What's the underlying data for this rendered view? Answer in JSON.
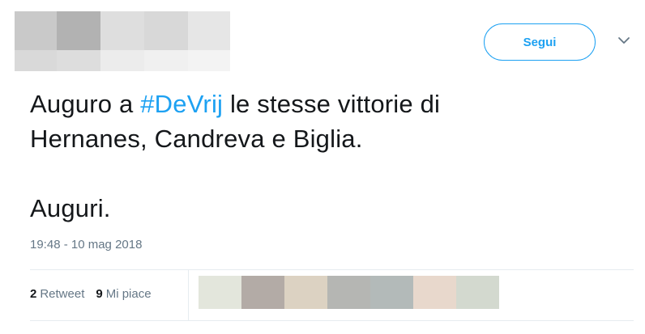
{
  "header": {
    "follow_label": "Segui",
    "chevron_icon": "chevron-down-icon",
    "accent_color": "#1da1f2"
  },
  "tweet": {
    "line1_before": "Auguro a ",
    "hashtag": "#DeVrij",
    "line1_after": " le stesse vittorie di",
    "line2": "Hernanes, Candreva e Biglia.",
    "line3": "Auguri.",
    "timestamp": "19:48 - 10 mag 2018"
  },
  "stats": {
    "retweet_count": "2",
    "retweet_label": "Retweet",
    "like_count": "9",
    "like_label": "Mi piace"
  },
  "liker_avatars": [
    {
      "color": "#e3e6dc"
    },
    {
      "color": "#b3aba6"
    },
    {
      "color": "#dcd2c2"
    },
    {
      "color": "#b5b6b3"
    },
    {
      "color": "#b3bab9"
    },
    {
      "color": "#e8d8cc"
    },
    {
      "color": "#d3d9cf"
    }
  ]
}
